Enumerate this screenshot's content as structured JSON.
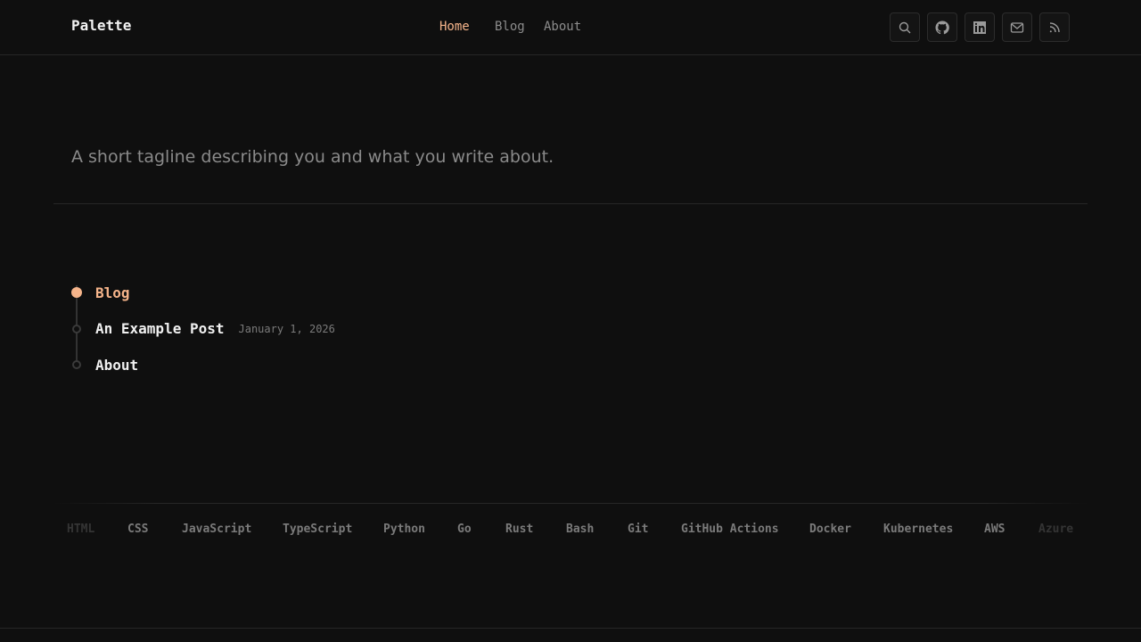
{
  "header": {
    "brand": "Palette",
    "nav": [
      {
        "label": "Home",
        "active": true
      },
      {
        "label": "Blog",
        "active": false
      },
      {
        "label": "About",
        "active": false
      }
    ],
    "icons": [
      "search-icon",
      "github-icon",
      "linkedin-icon",
      "mail-icon",
      "rss-icon"
    ]
  },
  "hero": {
    "tagline": "A short tagline describing you and what you write about."
  },
  "tree": {
    "items": [
      {
        "label": "Blog",
        "date": ""
      },
      {
        "label": "An Example Post",
        "date": "January 1, 2026"
      },
      {
        "label": "About",
        "date": ""
      }
    ]
  },
  "skills": {
    "items": [
      "HTML",
      "CSS",
      "JavaScript",
      "TypeScript",
      "Python",
      "Go",
      "Rust",
      "Bash",
      "Git",
      "GitHub Actions",
      "Docker",
      "Kubernetes",
      "AWS",
      "Azure"
    ]
  },
  "colors": {
    "background": "#0f0f0f",
    "accent": "#f5b48a",
    "muted": "#8c8c8c",
    "border": "#262626"
  }
}
